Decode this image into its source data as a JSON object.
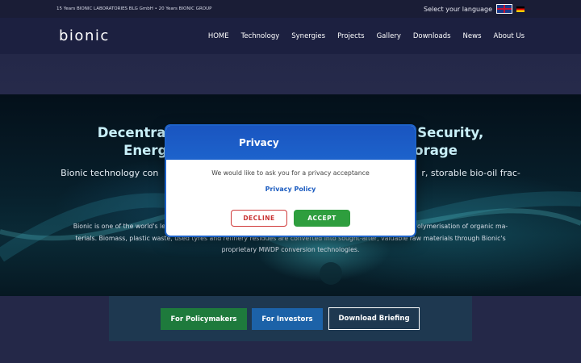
{
  "topbar": {
    "tagline": "15 Years BIONIC LABORATORIES BLG GmbH • 20 Years BIONIC GROUP",
    "language_label": "Select your language",
    "flags": [
      "uk-flag-icon",
      "de-flag-icon"
    ]
  },
  "header": {
    "logo": "bionic",
    "nav": [
      "HOME",
      "Technology",
      "Synergies",
      "Projects",
      "Gallery",
      "Downloads",
      "News",
      "About Us"
    ]
  },
  "hero": {
    "title_line1": "Decentral",
    "title_line1_right": "Security,",
    "title_line2": "Energ",
    "title_line2_right": "orage",
    "lead_left": "Bionic technology con",
    "lead_right": "r, storable bio-oil frac-",
    "para_line1_left": "Bionic is one of the world's le",
    "para_line1_right": "olymerisation of organic ma-",
    "para_line2": "terials. Biomass, plastic waste, used tyres and refinery residues are converted into sought-after, valuable raw materials through Bionic's",
    "para_line3": "proprietary MWDP conversion technologies."
  },
  "cta": {
    "policymakers": "For Policymakers",
    "investors": "For Investors",
    "briefing": "Download Briefing"
  },
  "modal": {
    "title": "Privacy",
    "text": "We would like to ask you for a privacy acceptance",
    "link": "Privacy Policy",
    "decline": "DECLINE",
    "accept": "ACCEPT"
  },
  "colors": {
    "modal_header": "#1d63cc",
    "accept": "#2e9e3e",
    "decline": "#d03a3a",
    "btn_policy": "#1e7a3c",
    "btn_invest": "#1c62a8"
  }
}
